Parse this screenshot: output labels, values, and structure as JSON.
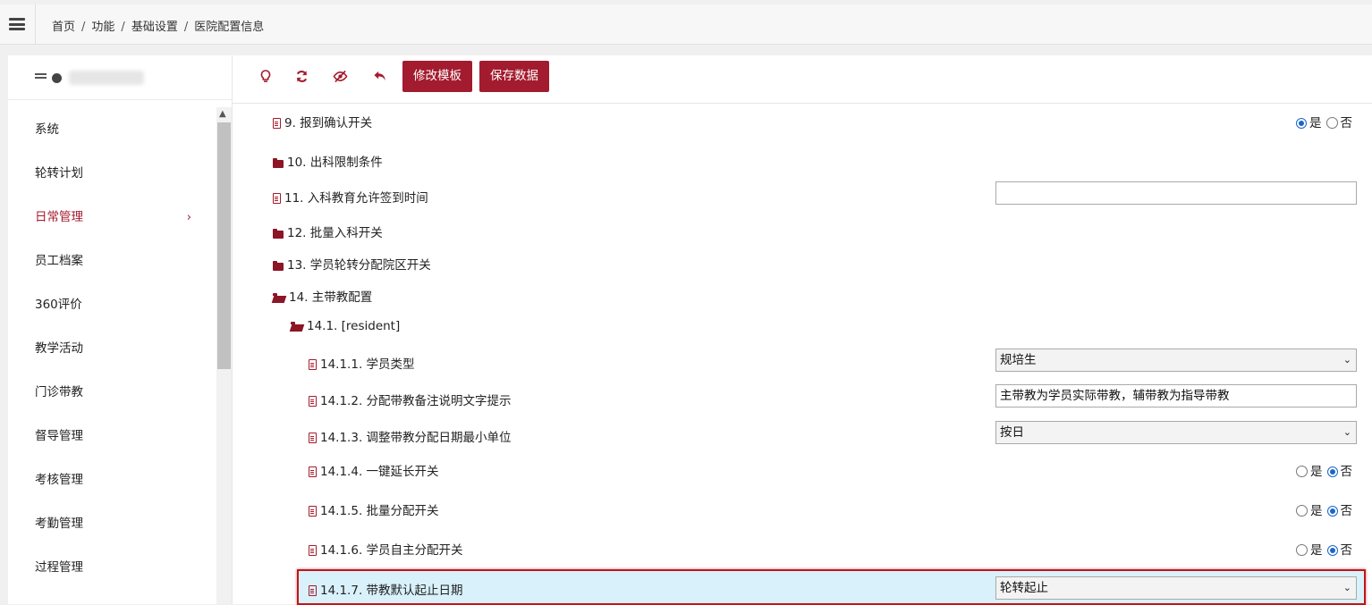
{
  "breadcrumb": [
    "首页",
    "功能",
    "基础设置",
    "医院配置信息"
  ],
  "sidebar": {
    "items": [
      {
        "label": "系统"
      },
      {
        "label": "轮转计划"
      },
      {
        "label": "日常管理",
        "active": true,
        "chevron": "›"
      },
      {
        "label": "员工档案"
      },
      {
        "label": "360评价"
      },
      {
        "label": "教学活动"
      },
      {
        "label": "门诊带教"
      },
      {
        "label": "督导管理"
      },
      {
        "label": "考核管理"
      },
      {
        "label": "考勤管理"
      },
      {
        "label": "过程管理"
      }
    ]
  },
  "toolbar": {
    "icons": [
      "lightbulb-icon",
      "refresh-icon",
      "eye-slash-icon",
      "undo-icon"
    ],
    "edit_template_label": "修改模板",
    "save_data_label": "保存数据"
  },
  "config_rows": [
    {
      "label": "9. 报到确认开关",
      "type": "file",
      "control": "radio",
      "yes": "是",
      "no": "否",
      "selected": "yes"
    },
    {
      "label": "10. 出科限制条件",
      "type": "folder"
    },
    {
      "label": "11. 入科教育允许签到时间",
      "type": "file",
      "control": "input",
      "value": ""
    },
    {
      "label": "12. 批量入科开关",
      "type": "folder"
    },
    {
      "label": "13. 学员轮转分配院区开关",
      "type": "folder"
    },
    {
      "label": "14. 主带教配置",
      "type": "folder-open"
    },
    {
      "label": "14.1. [resident]",
      "type": "folder-open"
    },
    {
      "label": "14.1.1. 学员类型",
      "type": "file",
      "control": "select",
      "value": "规培生"
    },
    {
      "label": "14.1.2. 分配带教备注说明文字提示",
      "type": "file",
      "control": "input",
      "value": "主带教为学员实际带教，辅带教为指导带教"
    },
    {
      "label": "14.1.3. 调整带教分配日期最小单位",
      "type": "file",
      "control": "select",
      "value": "按日"
    },
    {
      "label": "14.1.4. 一键延长开关",
      "type": "file",
      "control": "radio",
      "yes": "是",
      "no": "否",
      "selected": "no"
    },
    {
      "label": "14.1.5. 批量分配开关",
      "type": "file",
      "control": "radio",
      "yes": "是",
      "no": "否",
      "selected": "no"
    },
    {
      "label": "14.1.6. 学员自主分配开关",
      "type": "file",
      "control": "radio",
      "yes": "是",
      "no": "否",
      "selected": "no"
    },
    {
      "label": "14.1.7. 带教默认起止日期",
      "type": "file",
      "control": "select",
      "value": "轮转起止",
      "highlighted": true
    }
  ],
  "colors": {
    "accent": "#a31b2e",
    "radio_selected": "#1a66c9",
    "highlight_border": "#c01518",
    "highlight_bg": "#d9f1fb"
  }
}
